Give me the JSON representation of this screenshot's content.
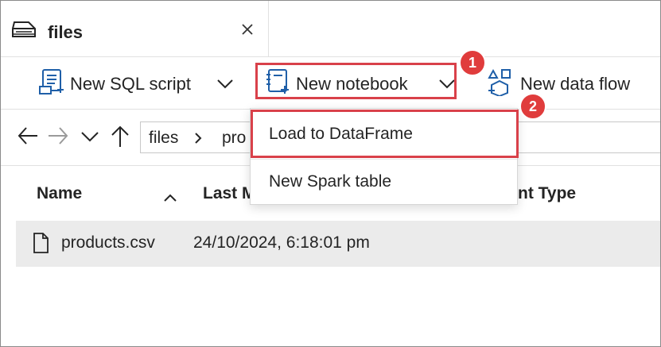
{
  "tab": {
    "label": "files",
    "icon": "storage-icon",
    "close_icon": "close-icon"
  },
  "toolbar": {
    "new_sql_script": "New SQL script",
    "new_notebook": "New notebook",
    "new_data_flow": "New data flow",
    "icons": [
      "sql-script-icon",
      "notebook-icon",
      "data-flow-icon",
      "chevron-down-icon"
    ]
  },
  "callouts": {
    "badge_1": "1",
    "badge_2": "2",
    "color": "#d9414a"
  },
  "nav": {
    "path": [
      "files",
      "pro"
    ],
    "icons": [
      "arrow-left-icon",
      "arrow-right-icon",
      "chevron-down-icon",
      "arrow-up-icon"
    ]
  },
  "table": {
    "headers": {
      "name": "Name",
      "last_modified": "Last M",
      "content_type": "nt Type"
    },
    "sort_icon": "sort-ascending-icon",
    "rows": [
      {
        "name": "products.csv",
        "last_modified": "24/10/2024, 6:18:01 pm"
      }
    ]
  },
  "menu": {
    "items": [
      {
        "label": "Load to DataFrame"
      },
      {
        "label": "New Spark table"
      }
    ]
  },
  "colors": {
    "accent": "#1f5fa8",
    "highlight": "#d9414a",
    "row_selected": "#ebebeb"
  }
}
